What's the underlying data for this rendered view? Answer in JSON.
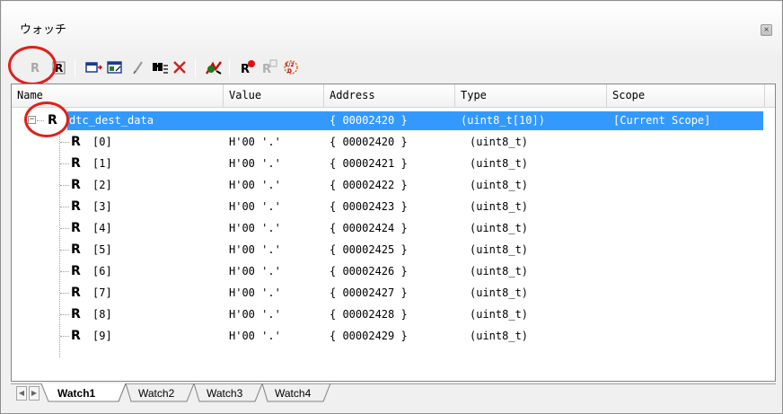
{
  "window": {
    "title": "ウォッチ",
    "close_glyph": "×"
  },
  "toolbar": {
    "buttons": [
      {
        "name": "register-disabled-icon"
      },
      {
        "name": "register-icon"
      },
      {
        "name": "window-icon"
      },
      {
        "name": "memory-view-icon"
      },
      {
        "name": "edit-pencil-icon"
      },
      {
        "name": "find-icon"
      },
      {
        "name": "delete-icon"
      },
      {
        "name": "refresh-icon"
      },
      {
        "name": "register-breakpoint-icon"
      },
      {
        "name": "register-breakpoint-disabled-icon"
      },
      {
        "name": "realtime-icon"
      }
    ]
  },
  "grid": {
    "columns": [
      "Name",
      "Value",
      "Address",
      "Type",
      "Scope"
    ],
    "rows": [
      {
        "name": "dtc_dest_data",
        "value": "",
        "address": "{ 00002420 }",
        "type": "(uint8_t[10])",
        "scope": "[Current Scope]",
        "selected": true,
        "expandable": true
      },
      {
        "name": "[0]",
        "value": "H'00 '.'",
        "address": "{ 00002420 }",
        "type": "(uint8_t)",
        "scope": ""
      },
      {
        "name": "[1]",
        "value": "H'00 '.'",
        "address": "{ 00002421 }",
        "type": "(uint8_t)",
        "scope": ""
      },
      {
        "name": "[2]",
        "value": "H'00 '.'",
        "address": "{ 00002422 }",
        "type": "(uint8_t)",
        "scope": ""
      },
      {
        "name": "[3]",
        "value": "H'00 '.'",
        "address": "{ 00002423 }",
        "type": "(uint8_t)",
        "scope": ""
      },
      {
        "name": "[4]",
        "value": "H'00 '.'",
        "address": "{ 00002424 }",
        "type": "(uint8_t)",
        "scope": ""
      },
      {
        "name": "[5]",
        "value": "H'00 '.'",
        "address": "{ 00002425 }",
        "type": "(uint8_t)",
        "scope": ""
      },
      {
        "name": "[6]",
        "value": "H'00 '.'",
        "address": "{ 00002426 }",
        "type": "(uint8_t)",
        "scope": ""
      },
      {
        "name": "[7]",
        "value": "H'00 '.'",
        "address": "{ 00002427 }",
        "type": "(uint8_t)",
        "scope": ""
      },
      {
        "name": "[8]",
        "value": "H'00 '.'",
        "address": "{ 00002428 }",
        "type": "(uint8_t)",
        "scope": ""
      },
      {
        "name": "[9]",
        "value": "H'00 '.'",
        "address": "{ 00002429 }",
        "type": "(uint8_t)",
        "scope": ""
      }
    ],
    "register_glyph": "R",
    "expander_glyph": "−"
  },
  "tabs": [
    {
      "label": "Watch1",
      "active": true
    },
    {
      "label": "Watch2",
      "active": false
    },
    {
      "label": "Watch3",
      "active": false
    },
    {
      "label": "Watch4",
      "active": false
    }
  ],
  "colors": {
    "selection": "#3399ff",
    "highlight_circle": "#e0201a"
  }
}
